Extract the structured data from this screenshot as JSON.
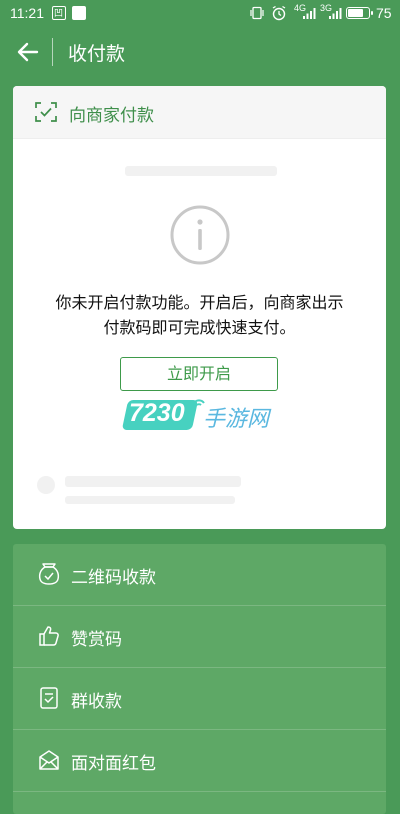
{
  "status_bar": {
    "time": "11:21",
    "notif_icon_text": "凹",
    "signal_4g": "4G",
    "signal_3g": "3G",
    "battery_pct": "75",
    "battery_level": 0.75
  },
  "header": {
    "title": "收付款"
  },
  "card": {
    "title": "向商家付款",
    "notice_line1": "你未开启付款功能。开启后，向商家出示",
    "notice_line2": "付款码即可完成快速支付。",
    "enable_button": "立即开启"
  },
  "watermark": {
    "number": "7230",
    "text": "手游网"
  },
  "menu": {
    "items": [
      {
        "label": "二维码收款",
        "icon": "money-bag-icon"
      },
      {
        "label": "赞赏码",
        "icon": "thumbs-up-icon"
      },
      {
        "label": "群收款",
        "icon": "group-receipt-icon"
      },
      {
        "label": "面对面红包",
        "icon": "red-packet-icon"
      }
    ]
  },
  "colors": {
    "background": "#4a9a58",
    "accent": "#3e9a4a",
    "menu_bg": "#5ea866"
  }
}
